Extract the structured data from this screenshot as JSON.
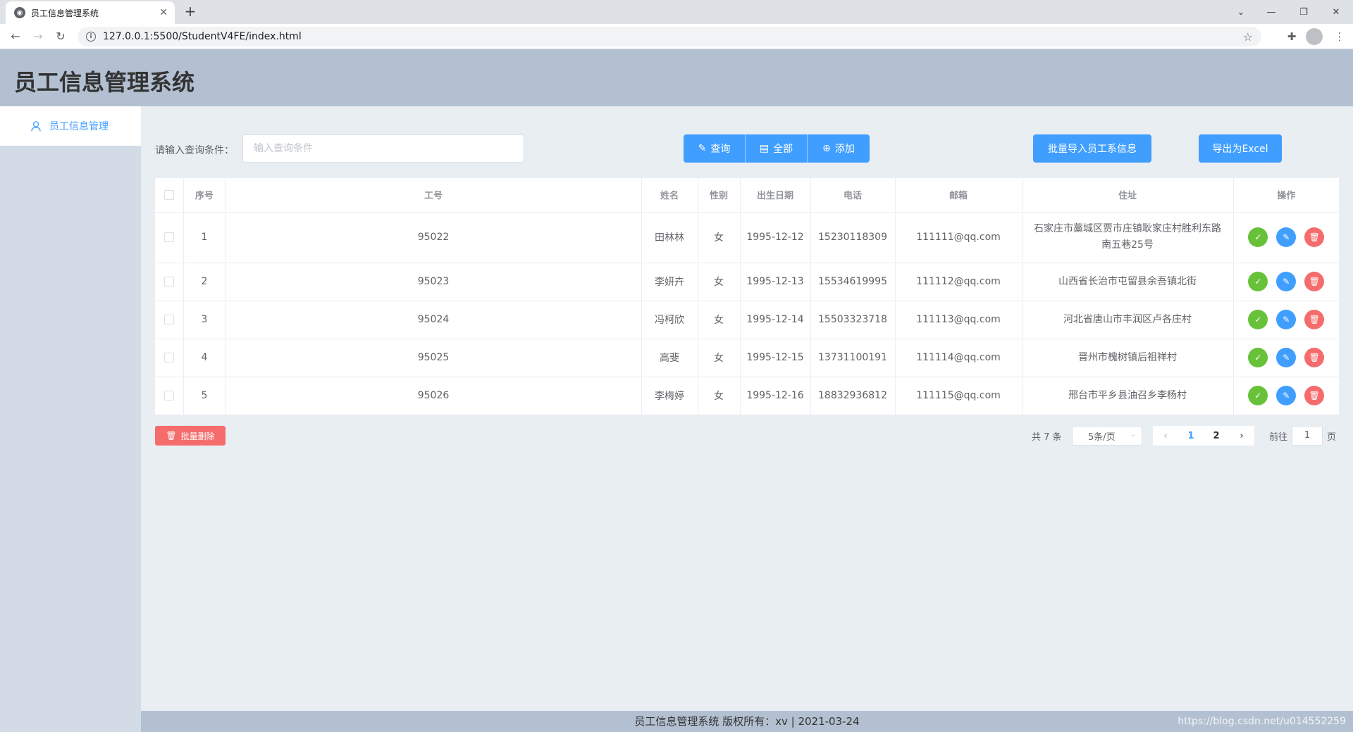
{
  "browser": {
    "tab_title": "员工信息管理系统",
    "url": "127.0.0.1:5500/StudentV4FE/index.html"
  },
  "header": {
    "title": "员工信息管理系统"
  },
  "sidebar": {
    "items": [
      {
        "label": "员工信息管理",
        "icon": "user-icon"
      }
    ]
  },
  "query": {
    "label": "请输入查询条件：",
    "placeholder": "输入查询条件",
    "buttons": {
      "search": "查询",
      "all": "全部",
      "add": "添加"
    },
    "import_label": "批量导入员工系信息",
    "export_label": "导出为Excel"
  },
  "table": {
    "columns": [
      "序号",
      "工号",
      "姓名",
      "性别",
      "出生日期",
      "电话",
      "邮箱",
      "住址",
      "操作"
    ],
    "rows": [
      {
        "index": "1",
        "id": "95022",
        "name": "田林林",
        "gender": "女",
        "birth": "1995-12-12",
        "phone": "15230118309",
        "email": "111111@qq.com",
        "address": "石家庄市藁城区贾市庄镇耿家庄村胜利东路南五巷25号"
      },
      {
        "index": "2",
        "id": "95023",
        "name": "李妍卉",
        "gender": "女",
        "birth": "1995-12-13",
        "phone": "15534619995",
        "email": "111112@qq.com",
        "address": "山西省长治市屯留县余吾镇北街"
      },
      {
        "index": "3",
        "id": "95024",
        "name": "冯柯欣",
        "gender": "女",
        "birth": "1995-12-14",
        "phone": "15503323718",
        "email": "111113@qq.com",
        "address": "河北省唐山市丰润区卢各庄村"
      },
      {
        "index": "4",
        "id": "95025",
        "name": "高斐",
        "gender": "女",
        "birth": "1995-12-15",
        "phone": "13731100191",
        "email": "111114@qq.com",
        "address": "晋州市槐树镇后祖祥村"
      },
      {
        "index": "5",
        "id": "95026",
        "name": "李梅婷",
        "gender": "女",
        "birth": "1995-12-16",
        "phone": "18832936812",
        "email": "111115@qq.com",
        "address": "邢台市平乡县油召乡李杨村"
      }
    ]
  },
  "batch_delete_label": "批量删除",
  "pagination": {
    "total_text": "共 7 条",
    "page_size": "5条/页",
    "pages": [
      "1",
      "2"
    ],
    "current_page": "1",
    "goto_label": "前往",
    "goto_value": "1",
    "page_unit": "页"
  },
  "footer": {
    "text": "员工信息管理系统 版权所有：xv | 2021-03-24",
    "watermark": "https://blog.csdn.net/u014552259"
  },
  "colors": {
    "primary": "#409eff",
    "success": "#67c23a",
    "danger": "#f56c6c",
    "header_bg": "#b3c0d1",
    "sidebar_bg": "#d3dce6",
    "main_bg": "#e9eef3"
  }
}
